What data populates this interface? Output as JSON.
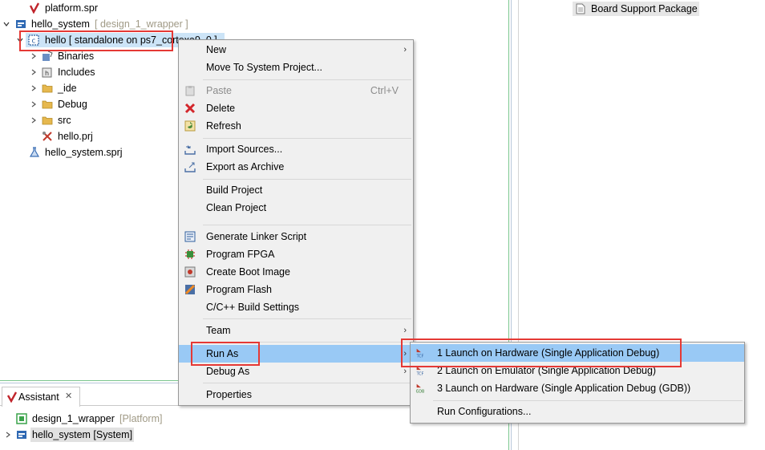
{
  "tree": {
    "platform_spr": "platform.spr",
    "hello_system": "hello_system",
    "hello_system_suffix": "[ design_1_wrapper ]",
    "hello": "hello [ standalone on ps7_cortexa9_0 ]",
    "children": [
      "Binaries",
      "Includes",
      "_ide",
      "Debug",
      "src",
      "hello.prj"
    ],
    "hello_system_sprj": "hello_system.sprj"
  },
  "right_panel": {
    "bsp_label": "Board Support Package"
  },
  "assistant": {
    "tab_label": "Assistant",
    "close_glyph": "✕",
    "items": [
      {
        "label": "design_1_wrapper",
        "suffix": "[Platform]"
      },
      {
        "label": "hello_system [System]",
        "suffix": ""
      }
    ]
  },
  "context_menu": {
    "new": "New",
    "move_to_system": "Move To System Project...",
    "paste": "Paste",
    "paste_shortcut": "Ctrl+V",
    "delete": "Delete",
    "refresh": "Refresh",
    "import_sources": "Import Sources...",
    "export_archive": "Export as Archive",
    "build_project": "Build Project",
    "clean_project": "Clean Project",
    "generate_linker": "Generate Linker Script",
    "program_fpga": "Program FPGA",
    "create_boot": "Create Boot Image",
    "program_flash": "Program Flash",
    "build_settings": "C/C++ Build Settings",
    "team": "Team",
    "run_as": "Run As",
    "debug_as": "Debug As",
    "properties": "Properties",
    "submenu_arrow": "›"
  },
  "submenu": {
    "launch_hw": "1 Launch on Hardware (Single Application Debug)",
    "launch_emu": "2 Launch on Emulator (Single Application Debug)",
    "launch_gdb": "3 Launch on Hardware (Single Application Debug (GDB))",
    "run_configs": "Run Configurations..."
  },
  "colors": {
    "highlight": "#99c9f5",
    "annotation_red": "#e53935",
    "menu_bg": "#f0f0f0",
    "panel_green": "#7ac68d"
  }
}
